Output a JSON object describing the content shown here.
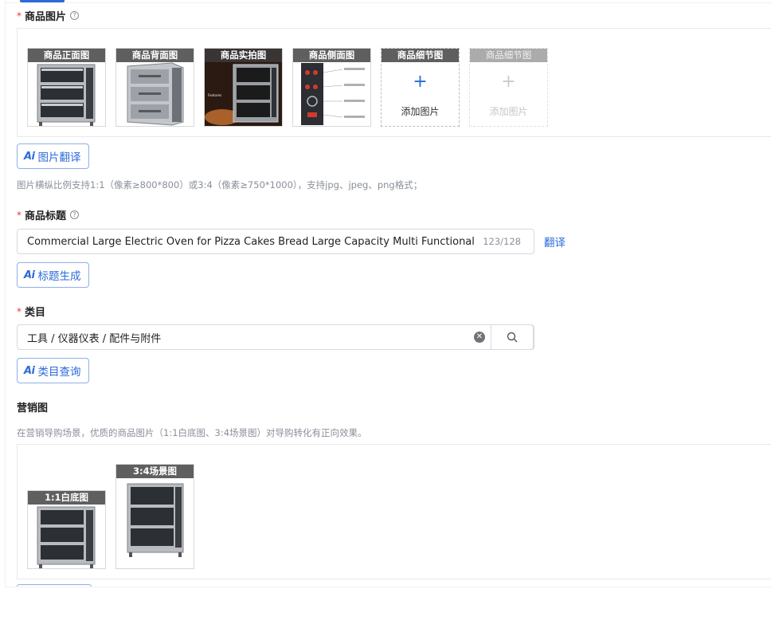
{
  "product_images": {
    "label": "商品图片",
    "required_mark": "*",
    "help_icon": "question-circle-icon",
    "thumbnails": [
      {
        "caption": "商品正面图",
        "kind": "oven-front"
      },
      {
        "caption": "商品背面图",
        "kind": "oven-angle"
      },
      {
        "caption": "商品实拍图",
        "kind": "oven-real"
      },
      {
        "caption": "商品侧面图",
        "kind": "oven-diagram"
      }
    ],
    "add_slots": [
      {
        "caption": "商品细节图",
        "plus": "+",
        "text": "添加图片",
        "disabled": false
      },
      {
        "caption": "商品细节图",
        "plus": "+",
        "text": "添加图片",
        "disabled": true
      }
    ],
    "ai_button": "图片翻译",
    "hint": "图片横纵比例支持1:1（像素≥800*800）或3:4（像素≥750*1000），支持jpg、jpeg、png格式；"
  },
  "product_title": {
    "label": "商品标题",
    "required_mark": "*",
    "value": "Commercial Large Electric Oven for Pizza Cakes Bread Large Capacity Multi Functional Three",
    "counter": "123/128",
    "translate_link": "翻译",
    "ai_button": "标题生成"
  },
  "category": {
    "label": "类目",
    "required_mark": "*",
    "value": "工具 / 仪器仪表 / 配件与附件",
    "clear_icon": "clear-circle-icon",
    "search_icon": "search-icon",
    "ai_button": "类目查询"
  },
  "marketing": {
    "label": "营销图",
    "hint": "在营销导购场景，优质的商品图片（1:1白底图、3:4场景图）对导购转化有正向效果。",
    "thumbnails": [
      {
        "caption": "1:1白底图"
      },
      {
        "caption": "3:4场景图"
      }
    ]
  },
  "ai_mark": "Ai",
  "colors": {
    "accent": "#2b6bd8",
    "required": "#e53935",
    "hint": "#8a8f99"
  }
}
